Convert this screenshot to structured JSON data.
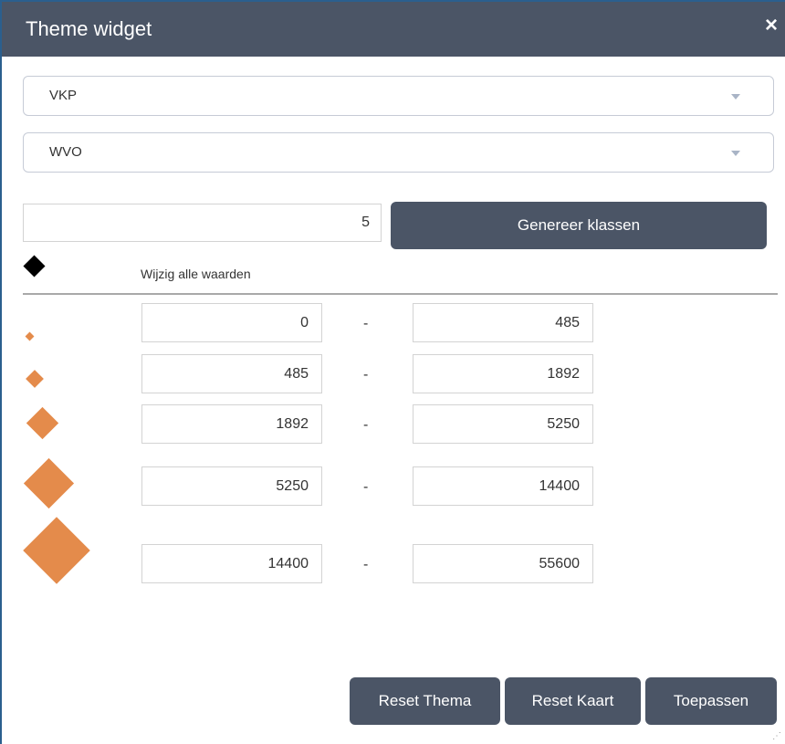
{
  "window": {
    "title": "Theme widget",
    "close_glyph": "×"
  },
  "layer_select": {
    "value": "VKP"
  },
  "field_select": {
    "value": "WVO"
  },
  "class_count": {
    "value": "5"
  },
  "generate_button": {
    "label": "Genereer klassen"
  },
  "edit_all": {
    "label": "Wijzig alle waarden"
  },
  "symbol_color": "#e48b4b",
  "header_symbol_color": "#000000",
  "classes": [
    {
      "from": "0",
      "sep": "-",
      "to": "485"
    },
    {
      "from": "485",
      "sep": "-",
      "to": "1892"
    },
    {
      "from": "1892",
      "sep": "-",
      "to": "5250"
    },
    {
      "from": "5250",
      "sep": "-",
      "to": "14400"
    },
    {
      "from": "14400",
      "sep": "-",
      "to": "55600"
    }
  ],
  "footer": {
    "reset_theme": "Reset Thema",
    "reset_map": "Reset Kaart",
    "apply": "Toepassen"
  }
}
